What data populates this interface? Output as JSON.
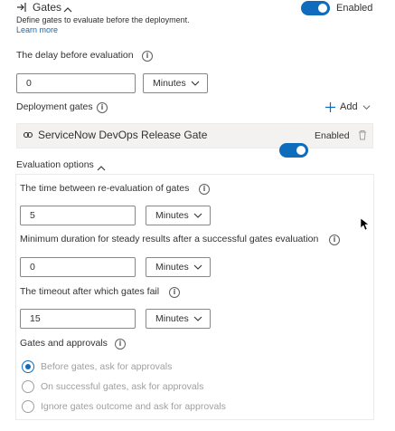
{
  "header": {
    "title": "Gates",
    "description": "Define gates to evaluate before the deployment.",
    "learn_more": "Learn more",
    "enabled_label": "Enabled"
  },
  "delay": {
    "label": "The delay before evaluation",
    "value": "0",
    "unit": "Minutes"
  },
  "deployment_gates": {
    "label": "Deployment gates",
    "add_label": "Add",
    "gate_name": "ServiceNow DevOps Release Gate",
    "gate_enabled_label": "Enabled"
  },
  "evaluation": {
    "section_label": "Evaluation options",
    "reeval": {
      "label": "The time between re-evaluation of gates",
      "value": "5",
      "unit": "Minutes"
    },
    "min_duration": {
      "label": "Minimum duration for steady results after a successful gates evaluation",
      "value": "0",
      "unit": "Minutes"
    },
    "timeout": {
      "label": "The timeout after which gates fail",
      "value": "15",
      "unit": "Minutes"
    }
  },
  "approvals": {
    "label": "Gates and approvals",
    "options": [
      "Before gates, ask for approvals",
      "On successful gates, ask for approvals",
      "Ignore gates outcome and ask for approvals"
    ],
    "selected_index": 0
  },
  "colors": {
    "accent": "#0f6cbd"
  }
}
